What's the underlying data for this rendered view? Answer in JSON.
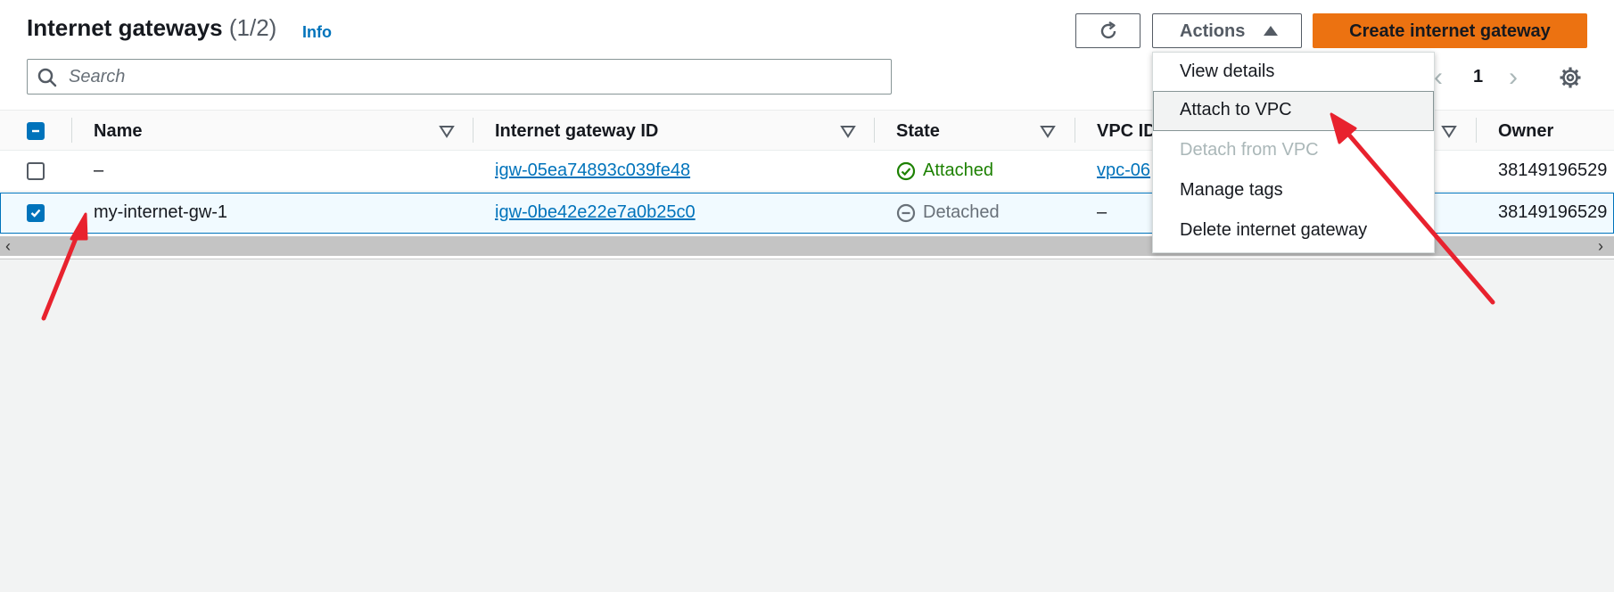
{
  "header": {
    "title": "Internet gateways",
    "count": "(1/2)",
    "info": "Info"
  },
  "search": {
    "placeholder": "Search"
  },
  "toolbar": {
    "actions_label": "Actions",
    "create_label": "Create internet gateway",
    "refresh_icon": "refresh-icon"
  },
  "pagination": {
    "page": "1",
    "prev": "‹",
    "next": "›"
  },
  "table": {
    "columns": [
      "Name",
      "Internet gateway ID",
      "State",
      "VPC ID",
      "Owner"
    ],
    "rows": [
      {
        "selected": false,
        "name": "–",
        "gateway_id": "igw-05ea74893c039fe48",
        "state": "Attached",
        "vpc_id": "vpc-06",
        "owner": "38149196529"
      },
      {
        "selected": true,
        "name": "my-internet-gw-1",
        "gateway_id": "igw-0be42e22e7a0b25c0",
        "state": "Detached",
        "vpc_id": "–",
        "owner": "38149196529"
      }
    ]
  },
  "actions_menu": {
    "items": [
      {
        "label": "View details",
        "state": "normal"
      },
      {
        "label": "Attach to VPC",
        "state": "hover"
      },
      {
        "label": "Detach from VPC",
        "state": "disabled"
      },
      {
        "label": "Manage tags",
        "state": "normal"
      },
      {
        "label": "Delete internet gateway",
        "state": "normal"
      }
    ]
  },
  "scrollbar": {
    "left": "‹",
    "right": "›"
  },
  "colors": {
    "accent": "#0073bb",
    "primary_button": "#ec7211",
    "attached": "#1d8102",
    "detached": "#687078",
    "annotation_arrow": "#e8222e"
  }
}
